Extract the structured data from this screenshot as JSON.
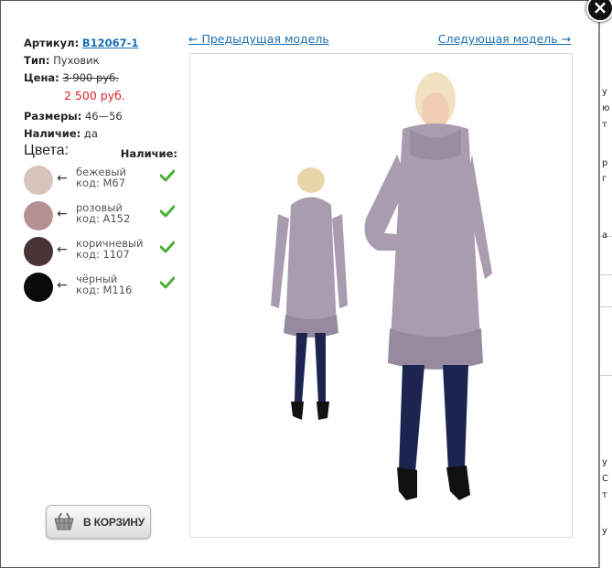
{
  "product": {
    "article_label": "Артикул:",
    "article_value": "B12067-1",
    "type_label": "Тип:",
    "type_value": "Пуховик",
    "price_label": "Цена:",
    "old_price": "3 900 руб.",
    "new_price": "2 500 руб.",
    "sizes_label": "Размеры:",
    "sizes_value": "46—56",
    "availability_label": "Наличие:",
    "availability_value": "да"
  },
  "colors": {
    "title": "Цвета:",
    "stock_header": "Наличие:",
    "items": [
      {
        "name": "бежевый",
        "code": "код: M67",
        "swatch": "#d9c3bd",
        "in_stock": true
      },
      {
        "name": "розовый",
        "code": "код: A152",
        "swatch": "#b59193",
        "in_stock": true
      },
      {
        "name": "коричневый",
        "code": "код: 1107",
        "swatch": "#4a3334",
        "in_stock": true
      },
      {
        "name": "чёрный",
        "code": "код: M116",
        "swatch": "#0a0a0a",
        "in_stock": true
      }
    ],
    "arrow": "←"
  },
  "cart": {
    "label": "В КОРЗИНУ",
    "icon": "basket-icon"
  },
  "nav": {
    "prev": "← Предыдущая модель",
    "next": "Следующая модель →"
  },
  "close": {
    "glyph": "×",
    "icon": "close-icon"
  },
  "theme": {
    "link": "#1a6fb3",
    "sale_price": "#e0202a",
    "check": "#4caf3a",
    "coat": "#a79aab"
  }
}
